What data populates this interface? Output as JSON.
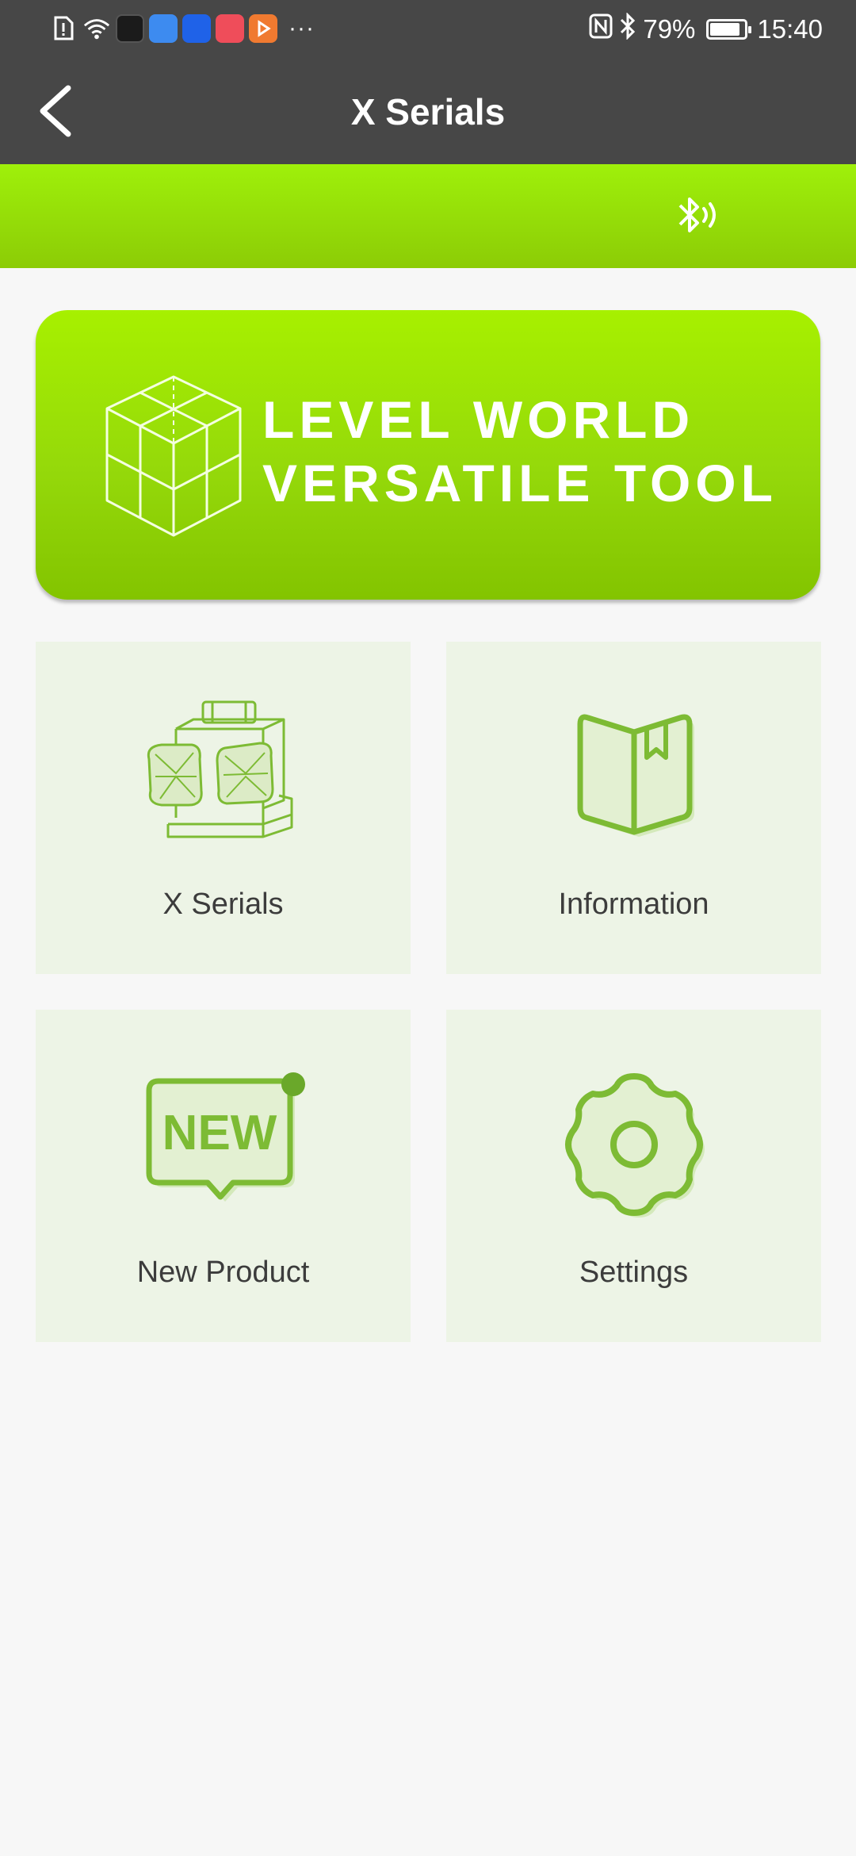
{
  "status_bar": {
    "battery": "79%",
    "battery_level": 0.79,
    "time": "15:40",
    "overflow": "···"
  },
  "header": {
    "title": "X Serials"
  },
  "banner": {
    "line1": "LEVEL WORLD",
    "line2": "VERSATILE TOOL"
  },
  "tiles": [
    {
      "label": "X Serials",
      "icon": "laser-level-icon"
    },
    {
      "label": "Information",
      "icon": "book-icon"
    },
    {
      "label": "New Product",
      "icon": "new-badge-icon",
      "badge_text": "NEW"
    },
    {
      "label": "Settings",
      "icon": "gear-icon"
    }
  ],
  "colors": {
    "accent_green": "#8ccc06",
    "icon_green": "#7dbb34",
    "tile_bg": "#edf4e6",
    "dark_bar": "#474747"
  }
}
